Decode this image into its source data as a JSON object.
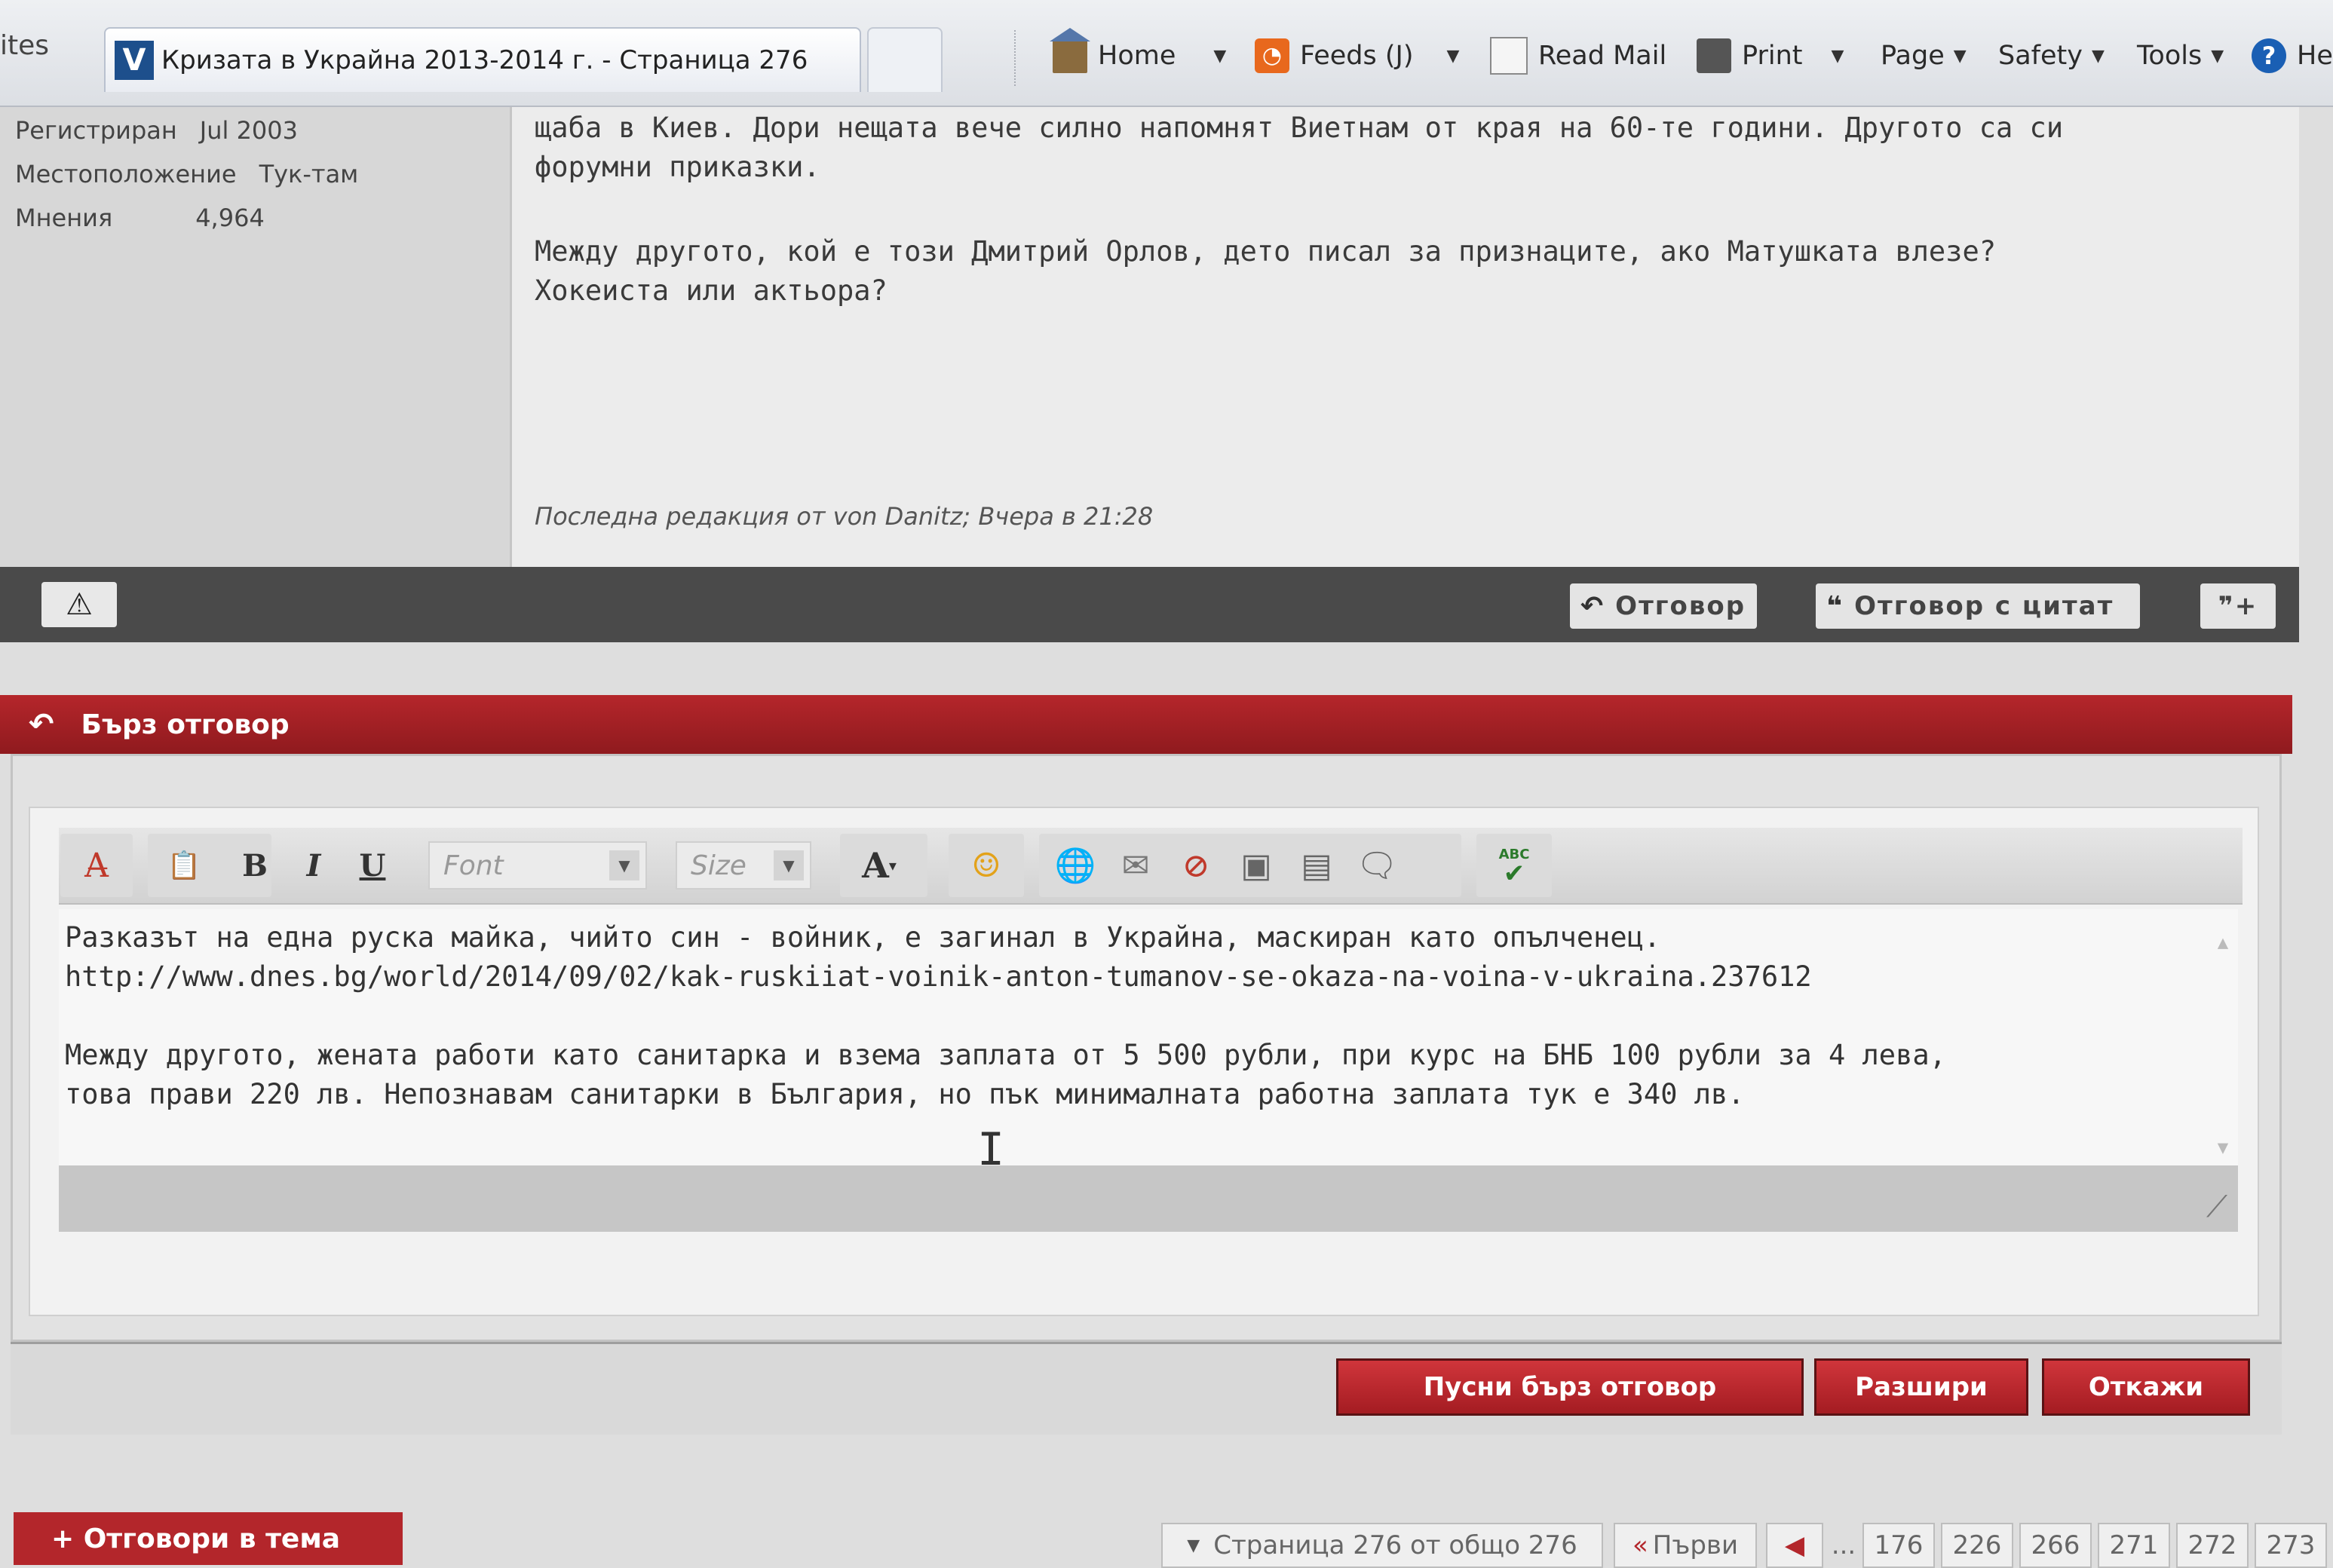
{
  "browser": {
    "favorites_stub": "ites",
    "tab_logo": "V",
    "tab_title": "Кризата в Украйна 2013-2014 г. - Страница 276",
    "toolbar": {
      "home": "Home",
      "feeds": "Feeds (J)",
      "read_mail": "Read Mail",
      "print": "Print",
      "page": "Page",
      "safety": "Safety",
      "tools": "Tools",
      "help": "He"
    }
  },
  "post": {
    "meta": [
      {
        "label": "Регистриран",
        "value": "Jul 2003"
      },
      {
        "label": "Местоположение",
        "value": "Тук-там"
      },
      {
        "label": "Мнения",
        "value": "4,964"
      }
    ],
    "lines": [
      "щаба в Киев. Дори нещата вече силно напомнят Виетнам от края на 60-те години. Другото са си",
      "форумни приказки.",
      "Между другото, кой е този Дмитрий Орлов, дето писал за признаците, ако Матушката влезе?",
      "Хокеиста или актьора?"
    ],
    "edit_note": "Последна редакция от von Danitz; Вчера в 21:28",
    "actions": {
      "reply": "Отговор",
      "reply_quote": "Отговор с цитат"
    }
  },
  "quick_reply": {
    "header": "Бърз отговор",
    "toolbar": {
      "bold": "B",
      "italic": "I",
      "underline": "U",
      "font_placeholder": "Font",
      "size_placeholder": "Size",
      "text_color": "A",
      "spellcheck": "ABC"
    },
    "editor_lines": [
      "Разказът на една руска майка, чийто син - войник, е загинал в Украйна, маскиран като опълченец.",
      "http://www.dnes.bg/world/2014/09/02/kak-ruskiiat-voinik-anton-tumanov-se-okaza-na-voina-v-ukraina.237612",
      "Между другото, жената работи като санитарка и взема заплата от 5 500 рубли, при курс на БНБ 100 рубли за 4 лева,",
      "това прави 220 лв. Непознавам санитарки в България, но пък минималната работна заплата тук е 340 лв."
    ],
    "buttons": {
      "submit": "Пусни бърз отговор",
      "expand": "Разшири",
      "cancel": "Откажи"
    }
  },
  "footer": {
    "reply_thread": "+ Отговори в тема",
    "page_info": "Страница 276 от общо 276",
    "first": "Първи",
    "ellipsis": "...",
    "pages": [
      "176",
      "226",
      "266",
      "271",
      "272",
      "273"
    ]
  }
}
